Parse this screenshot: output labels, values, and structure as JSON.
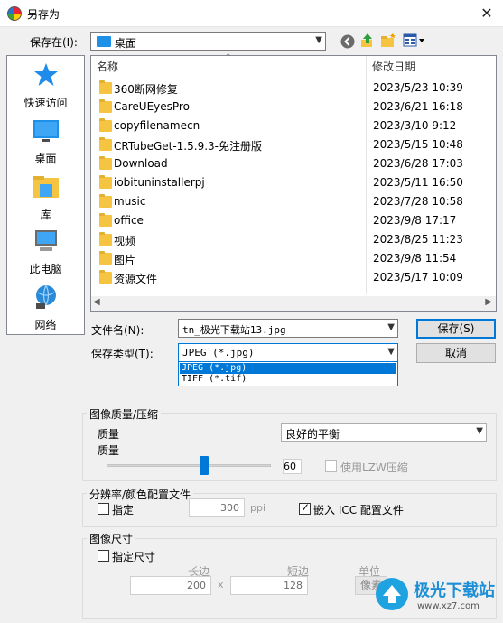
{
  "window": {
    "title": "另存为",
    "close_glyph": "✕"
  },
  "location": {
    "label": "保存在(I):",
    "value": "桌面"
  },
  "nav": [
    {
      "name": "quick-access",
      "label": "快速访问",
      "icon": "star-icon"
    },
    {
      "name": "desktop",
      "label": "桌面",
      "icon": "desktop-icon"
    },
    {
      "name": "library",
      "label": "库",
      "icon": "library-icon"
    },
    {
      "name": "this-pc",
      "label": "此电脑",
      "icon": "computer-icon"
    },
    {
      "name": "network",
      "label": "网络",
      "icon": "network-icon"
    }
  ],
  "list": {
    "col_name": "名称",
    "col_date": "修改日期",
    "rows": [
      {
        "name": "360断网修复",
        "date": "2023/5/23 10:39"
      },
      {
        "name": "CareUEyesPro",
        "date": "2023/6/21 16:18"
      },
      {
        "name": "copyfilenamecn",
        "date": "2023/3/10 9:12"
      },
      {
        "name": "CRTubeGet-1.5.9.3-免注册版",
        "date": "2023/5/15 10:48"
      },
      {
        "name": "Download",
        "date": "2023/6/28 17:03"
      },
      {
        "name": "iobituninstallerpj",
        "date": "2023/5/11 16:50"
      },
      {
        "name": "music",
        "date": "2023/7/28 10:58"
      },
      {
        "name": "office",
        "date": "2023/9/8 17:17"
      },
      {
        "name": "视频",
        "date": "2023/8/25 11:23"
      },
      {
        "name": "图片",
        "date": "2023/9/8 11:54"
      },
      {
        "name": "资源文件",
        "date": "2023/5/17 10:09"
      }
    ]
  },
  "filename": {
    "label": "文件名(N):",
    "value": "tn_极光下载站13.jpg"
  },
  "filetype": {
    "label": "保存类型(T):",
    "value": "JPEG (*.jpg)",
    "options": [
      "JPEG (*.jpg)",
      "TIFF (*.tif)"
    ]
  },
  "buttons": {
    "save": "保存(S)",
    "cancel": "取消"
  },
  "quality": {
    "title": "图像质量/压缩",
    "label1": "质量",
    "label2": "质量",
    "preset": "良好的平衡",
    "value": "60",
    "lzw_label": "使用LZW压缩"
  },
  "resolution": {
    "title": "分辨率/颜色配置文件",
    "specify_label": "指定",
    "value": "300",
    "unit": "ppi",
    "icc_label": "嵌入 ICC 配置文件"
  },
  "size": {
    "title": "图像尺寸",
    "specify_label": "指定尺寸",
    "long_label": "长边",
    "short_label": "短边",
    "unit_label": "单位",
    "long_value": "200",
    "times": "x",
    "short_value": "128",
    "unit_value": "像素"
  },
  "watermark": {
    "text": "极光下载站",
    "url": "www.xz7.com"
  },
  "colors": {
    "accent": "#0078d7",
    "folder": "#f5c542"
  }
}
